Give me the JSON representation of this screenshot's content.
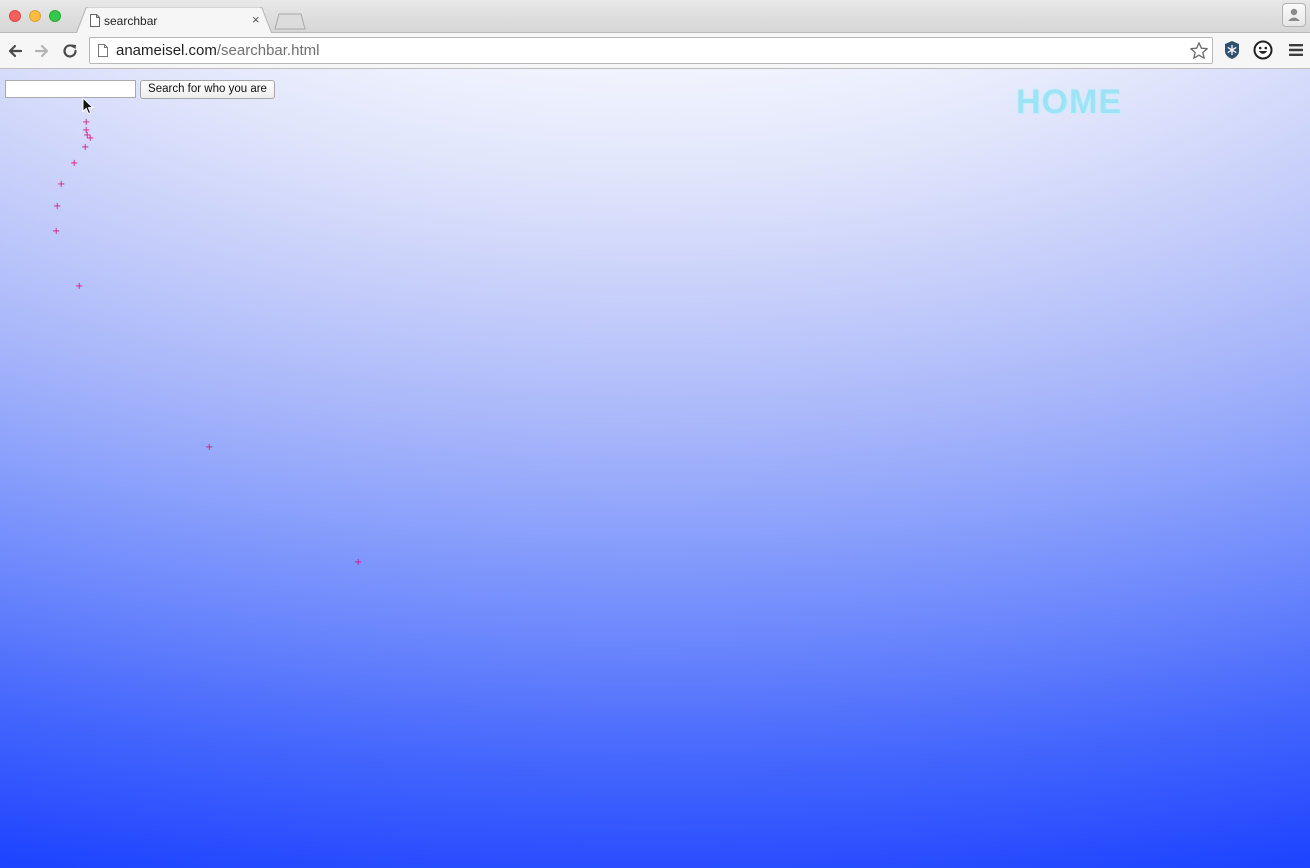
{
  "browser": {
    "tab_title": "searchbar",
    "tab_close": "×",
    "url_domain": "anameisel.com",
    "url_path": "/searchbar.html"
  },
  "page": {
    "search_placeholder": "",
    "search_value": "",
    "search_button_label": "Search for who you are",
    "home_label": "HOME",
    "sparkle_glyph": "+",
    "colors": {
      "home_text": "#9ee3f5",
      "sparkle": "#d6187e",
      "gradient_top": "#ffffff",
      "gradient_bottom": "#1e44ff"
    }
  },
  "icons": {
    "traffic_lights": [
      "close-dot",
      "minimize-dot",
      "maximize-dot"
    ],
    "tab": "page-icon",
    "toolbar": [
      "back-arrow-icon",
      "forward-arrow-icon",
      "reload-icon",
      "page-icon",
      "star-icon"
    ],
    "extensions": [
      "snowflake-icon",
      "smiley-icon",
      "menu-icon"
    ],
    "profile": "person-icon",
    "pointer": "arrow-cursor-icon"
  }
}
